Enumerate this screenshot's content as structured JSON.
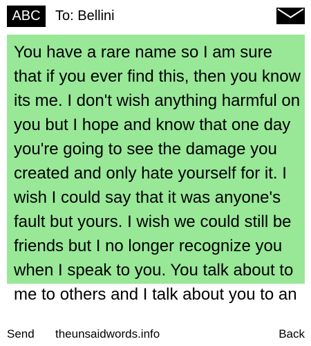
{
  "header": {
    "mode_label": "ABC",
    "recipient": "To: Bellini",
    "icon": "envelope-icon"
  },
  "message": {
    "text": "You have a rare name so I am sure that if you ever find this, then you know its me. I don't wish anything harmful on you but I hope and know that one day you're going to see the damage you created and only hate yourself for it. I wish I could say that it was anyone's fault but yours. I wish we could still be friends but I no longer recognize you when I speak to you. You talk about to me to others and I talk about you to an",
    "background_color": "#98e898"
  },
  "footer": {
    "left_softkey": "Send",
    "site": "theunsaidwords.info",
    "right_softkey": "Back"
  }
}
